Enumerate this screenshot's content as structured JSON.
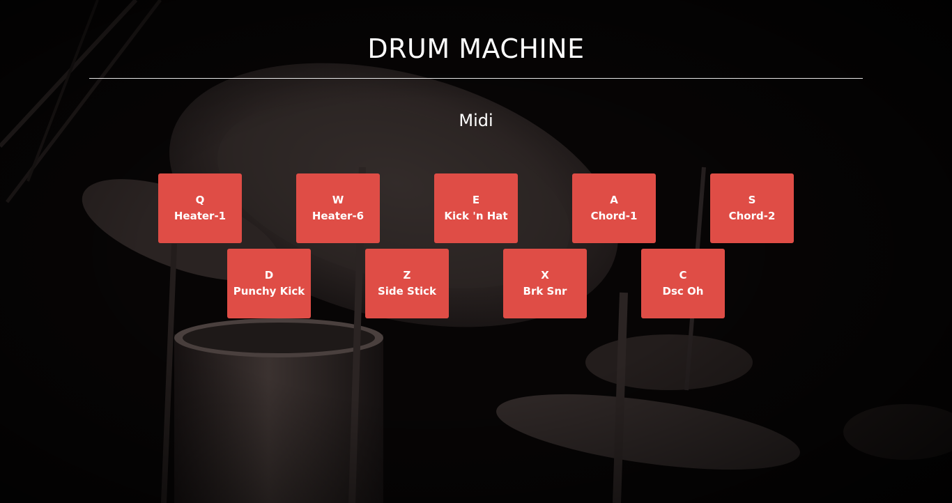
{
  "app": {
    "title": "DRUM MACHINE",
    "mode_label": "Midi"
  },
  "colors": {
    "pad": "#df4d46",
    "text": "#ffffff",
    "background": "#050404",
    "divider": "#e8e8e8"
  },
  "pads": [
    {
      "key": "Q",
      "name": "Heater-1"
    },
    {
      "key": "W",
      "name": "Heater-6"
    },
    {
      "key": "E",
      "name": "Kick 'n Hat"
    },
    {
      "key": "A",
      "name": "Chord-1"
    },
    {
      "key": "S",
      "name": "Chord-2"
    },
    {
      "key": "D",
      "name": "Punchy Kick"
    },
    {
      "key": "Z",
      "name": "Side Stick"
    },
    {
      "key": "X",
      "name": "Brk Snr"
    },
    {
      "key": "C",
      "name": "Dsc Oh"
    }
  ]
}
